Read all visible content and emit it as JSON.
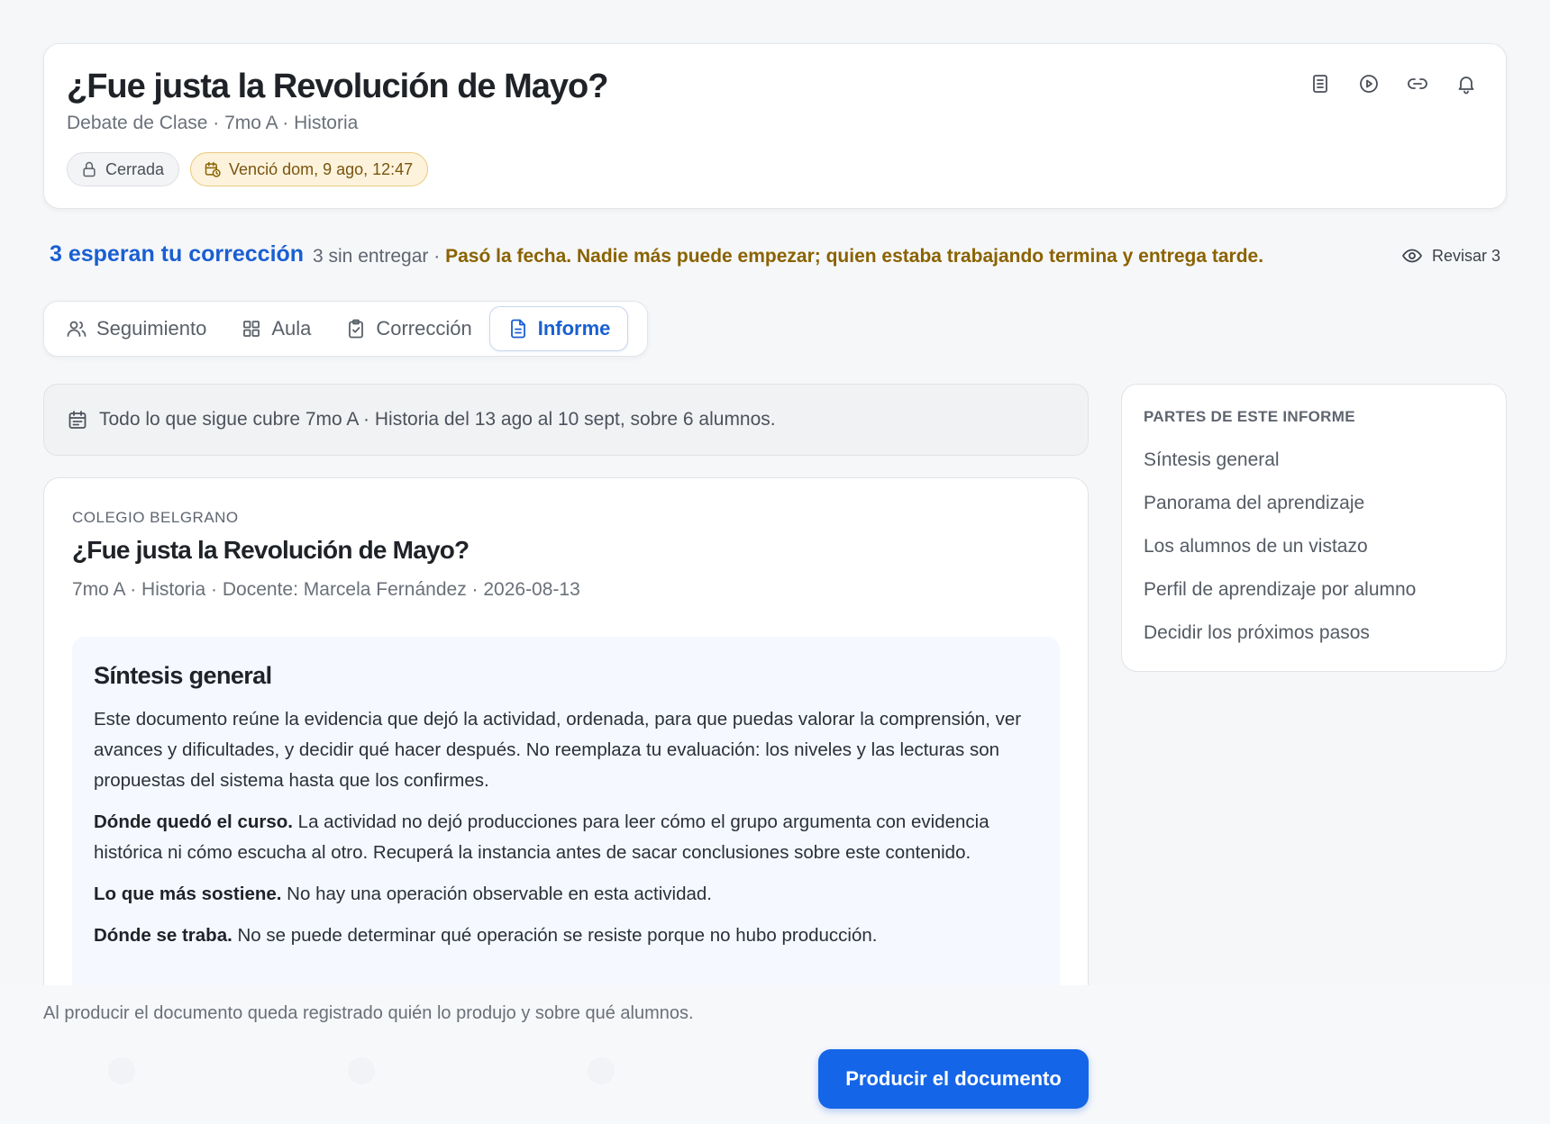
{
  "header": {
    "title": "¿Fue justa la Revolución de Mayo?",
    "subtitle": "Debate de Clase · 7mo A · Historia",
    "chip_closed": "Cerrada",
    "chip_due": "Venció dom, 9 ago, 12:47",
    "icons": [
      "document-icon",
      "play-icon",
      "link-icon",
      "bell-icon"
    ]
  },
  "status": {
    "pending": "3 esperan tu corrección",
    "not_submitted": "3 sin entregar · ",
    "warning": "Pasó la fecha. Nadie más puede empezar; quien estaba trabajando termina y entrega tarde.",
    "review": "Revisar 3"
  },
  "tabs": [
    {
      "label": "Seguimiento",
      "icon": "users-icon"
    },
    {
      "label": "Aula",
      "icon": "grid-icon"
    },
    {
      "label": "Corrección",
      "icon": "clipboard-check-icon"
    },
    {
      "label": "Informe",
      "icon": "file-text-icon",
      "active": true
    }
  ],
  "scope": "Todo lo que sigue cubre 7mo A · Historia del 13 ago al 10 sept, sobre 6 alumnos.",
  "document": {
    "school": "COLEGIO BELGRANO",
    "title": "¿Fue justa la Revolución de Mayo?",
    "meta": "7mo A · Historia · Docente: Marcela Fernández · 2026-08-13",
    "section_title": "Síntesis general",
    "intro": "Este documento reúne la evidencia que dejó la actividad, ordenada, para que puedas valorar la comprensión, ver avances y dificultades, y decidir qué hacer después. No reemplaza tu evaluación: los niveles y las lecturas son propuestas del sistema hasta que los confirmes.",
    "p1_label": "Dónde quedó el curso.",
    "p1_text": " La actividad no dejó producciones para leer cómo el grupo argumenta con evidencia histórica ni cómo escucha al otro. Recuperá la instancia antes de sacar conclusiones sobre este contenido.",
    "p2_label": "Lo que más sostiene.",
    "p2_text": " No hay una operación observable en esta actividad.",
    "p3_label": "Dónde se traba.",
    "p3_text": " No se puede determinar qué operación se resiste porque no hubo producción."
  },
  "sidebar": {
    "title": "PARTES DE ESTE INFORME",
    "items": [
      "Síntesis general",
      "Panorama del aprendizaje",
      "Los alumnos de un vistazo",
      "Perfil de aprendizaje por alumno",
      "Decidir los próximos pasos"
    ]
  },
  "footer": {
    "note": "Al producir el documento queda registrado quién lo produjo y sobre qué alumnos.",
    "button": "Producir el documento"
  },
  "colors": {
    "accent": "#1a5fd1",
    "button": "#1565e8",
    "warning": "#8a6200",
    "due_chip_bg": "#fdf3dc"
  }
}
